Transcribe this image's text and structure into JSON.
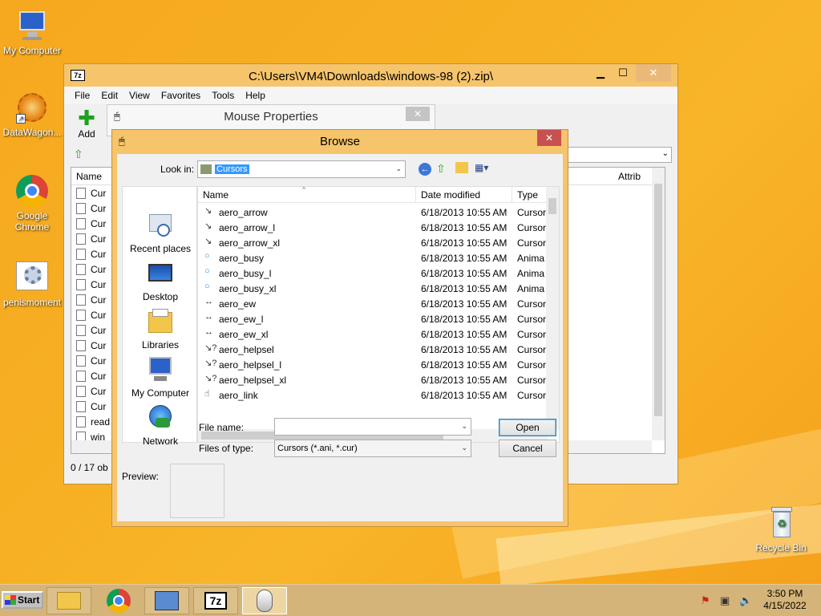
{
  "desktop": {
    "icons": [
      {
        "label": "My Computer",
        "icon": "computer-icon"
      },
      {
        "label": "DataWagon...",
        "icon": "datawagon-icon"
      },
      {
        "label": "Google Chrome",
        "icon": "chrome-icon"
      },
      {
        "label": "penismoment",
        "icon": "settings-app-icon"
      },
      {
        "label": "Recycle Bin",
        "icon": "recycle-bin-icon"
      }
    ]
  },
  "zip_window": {
    "title": "C:\\Users\\VM4\\Downloads\\windows-98 (2).zip\\",
    "app_icon": "7z",
    "menu": [
      "File",
      "Edit",
      "View",
      "Favorites",
      "Tools",
      "Help"
    ],
    "toolbar": {
      "add_label": "Add"
    },
    "columns": {
      "name": "Name",
      "attrib": "Attrib"
    },
    "rows": [
      "Cur",
      "Cur",
      "Cur",
      "Cur",
      "Cur",
      "Cur",
      "Cur",
      "Cur",
      "Cur",
      "Cur",
      "Cur",
      "Cur",
      "Cur",
      "Cur",
      "Cur",
      "read",
      "win"
    ],
    "status": "0 / 17 ob"
  },
  "mouse_properties": {
    "title": "Mouse Properties",
    "close": "✕"
  },
  "browse": {
    "title": "Browse",
    "close": "✕",
    "look_in_label": "Look in:",
    "look_in_value": "Cursors",
    "places": [
      "Recent places",
      "Desktop",
      "Libraries",
      "My Computer",
      "Network"
    ],
    "columns": {
      "name": "Name",
      "date": "Date modified",
      "type": "Type"
    },
    "files": [
      {
        "name": "aero_arrow",
        "date": "6/18/2013 10:55 AM",
        "type": "Cursor",
        "icon": "arrow-cursor-icon"
      },
      {
        "name": "aero_arrow_l",
        "date": "6/18/2013 10:55 AM",
        "type": "Cursor",
        "icon": "arrow-cursor-icon"
      },
      {
        "name": "aero_arrow_xl",
        "date": "6/18/2013 10:55 AM",
        "type": "Cursor",
        "icon": "arrow-cursor-icon"
      },
      {
        "name": "aero_busy",
        "date": "6/18/2013 10:55 AM",
        "type": "Anima",
        "icon": "busy-ring-icon"
      },
      {
        "name": "aero_busy_l",
        "date": "6/18/2013 10:55 AM",
        "type": "Anima",
        "icon": "busy-ring-icon"
      },
      {
        "name": "aero_busy_xl",
        "date": "6/18/2013 10:55 AM",
        "type": "Anima",
        "icon": "busy-ring-icon"
      },
      {
        "name": "aero_ew",
        "date": "6/18/2013 10:55 AM",
        "type": "Cursor",
        "icon": "ew-resize-icon"
      },
      {
        "name": "aero_ew_l",
        "date": "6/18/2013 10:55 AM",
        "type": "Cursor",
        "icon": "ew-resize-icon"
      },
      {
        "name": "aero_ew_xl",
        "date": "6/18/2013 10:55 AM",
        "type": "Cursor",
        "icon": "ew-resize-icon"
      },
      {
        "name": "aero_helpsel",
        "date": "6/18/2013 10:55 AM",
        "type": "Cursor",
        "icon": "help-cursor-icon"
      },
      {
        "name": "aero_helpsel_l",
        "date": "6/18/2013 10:55 AM",
        "type": "Cursor",
        "icon": "help-cursor-icon"
      },
      {
        "name": "aero_helpsel_xl",
        "date": "6/18/2013 10:55 AM",
        "type": "Cursor",
        "icon": "help-cursor-icon"
      },
      {
        "name": "aero_link",
        "date": "6/18/2013 10:55 AM",
        "type": "Cursor",
        "icon": "hand-cursor-icon"
      }
    ],
    "file_name_label": "File name:",
    "file_name_value": "",
    "files_of_type_label": "Files of type:",
    "files_of_type_value": "Cursors (*.ani, *.cur)",
    "open_label": "Open",
    "cancel_label": "Cancel",
    "preview_label": "Preview:"
  },
  "taskbar": {
    "start_label": "Start",
    "zip_label": "7z",
    "time": "3:50 PM",
    "date": "4/15/2022"
  },
  "colors": {
    "title_active": "#f6c46a",
    "selection": "#3399ff",
    "accent_close": "#c75050"
  }
}
